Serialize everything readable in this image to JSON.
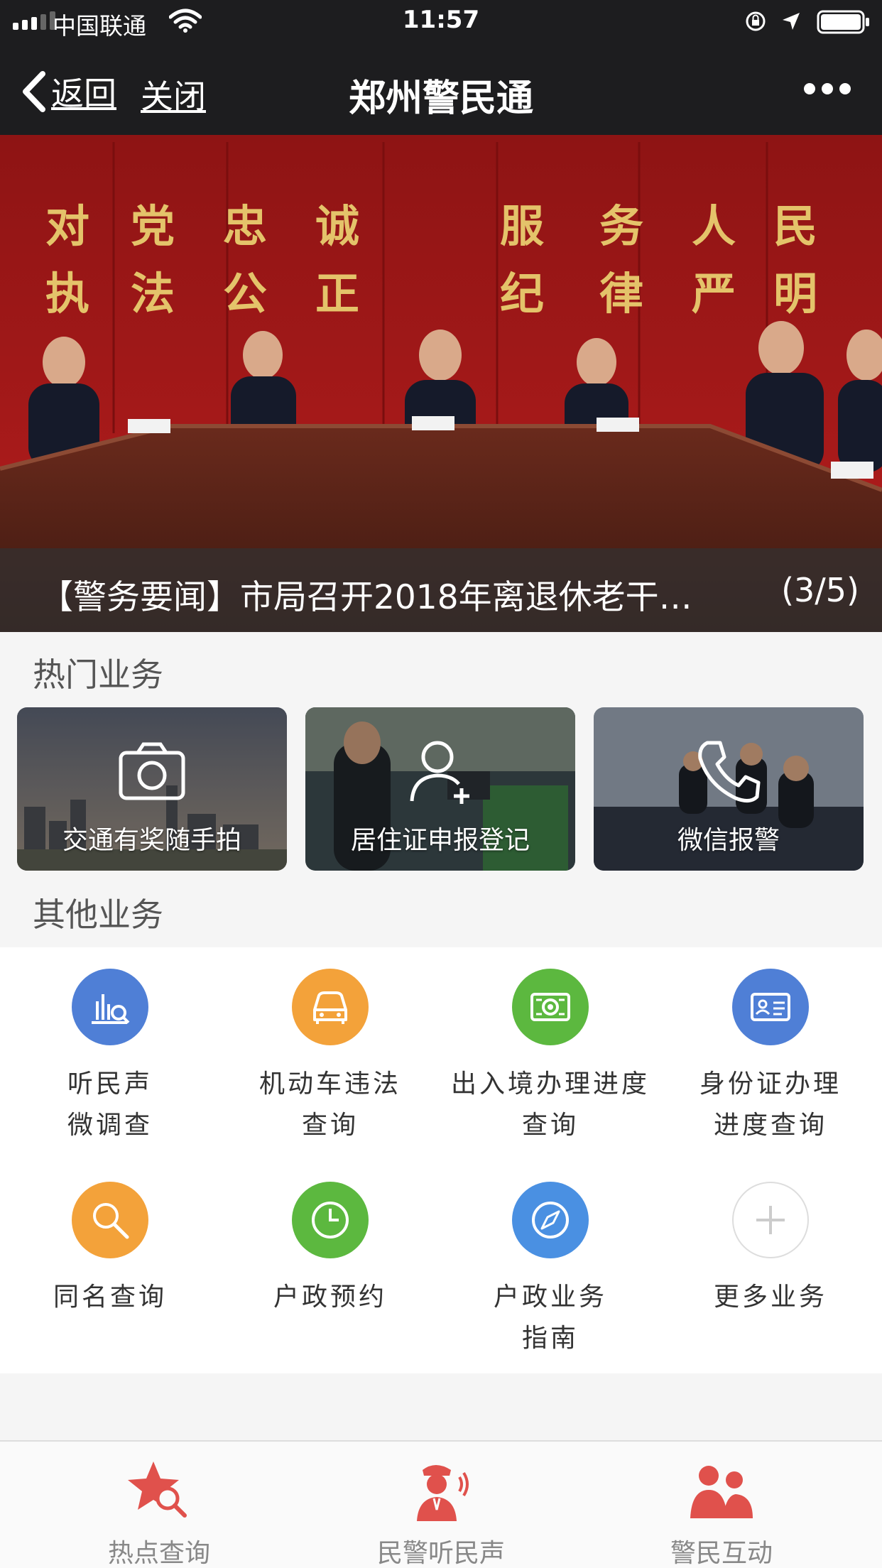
{
  "status_bar": {
    "carrier": "中国联通",
    "time": "11:57"
  },
  "nav": {
    "back_label": "返回",
    "close_label": "关闭",
    "title": "郑州警民通"
  },
  "banner": {
    "caption": "【警务要闻】市局召开2018年离退休老干…",
    "counter": "(3/5)",
    "wall_text_row1": [
      "对",
      "党",
      "忠",
      "诚",
      "服",
      "务",
      "人",
      "民"
    ],
    "wall_text_row2": [
      "执",
      "法",
      "公",
      "正",
      "纪",
      "律",
      "严",
      "明"
    ]
  },
  "hot_services": {
    "title": "热门业务",
    "items": [
      {
        "label": "交通有奖随手拍",
        "icon": "camera-icon"
      },
      {
        "label": "居住证申报登记",
        "icon": "add-user-icon"
      },
      {
        "label": "微信报警",
        "icon": "phone-icon"
      }
    ]
  },
  "other_services": {
    "title": "其他业务",
    "items": [
      {
        "label": "听民声\n微调查",
        "icon": "survey-chart-icon",
        "color": "#4f7fd6"
      },
      {
        "label": "机动车违法\n查询",
        "icon": "car-icon",
        "color": "#f3a23a"
      },
      {
        "label": "出入境办理进度\n查询",
        "icon": "passport-icon",
        "color": "#5cb83f"
      },
      {
        "label": "身份证办理\n进度查询",
        "icon": "id-card-icon",
        "color": "#4f7fd6"
      },
      {
        "label": "同名查询",
        "icon": "search-icon",
        "color": "#f3a23a"
      },
      {
        "label": "户政预约",
        "icon": "clock-icon",
        "color": "#5cb83f"
      },
      {
        "label": "户政业务\n指南",
        "icon": "compass-icon",
        "color": "#4a90e2"
      },
      {
        "label": "更多业务",
        "icon": "plus-icon",
        "color": "#ffffff"
      }
    ]
  },
  "tabbar": {
    "items": [
      {
        "label": "热点查询",
        "icon": "star-search-icon"
      },
      {
        "label": "民警听民声",
        "icon": "police-officer-icon"
      },
      {
        "label": "警民互动",
        "icon": "people-icon"
      }
    ]
  },
  "colors": {
    "accent_red": "#e0514c",
    "topbar": "#1d1d1f"
  }
}
